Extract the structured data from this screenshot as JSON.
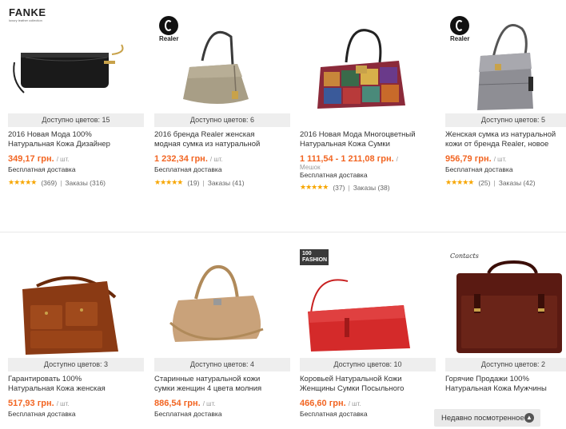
{
  "row1": [
    {
      "brand": "FANKE",
      "brand_sub": "luxury leather collection",
      "colors": "Доступно цветов: 15",
      "title_lines": [
        "2016 Новая Мода 100%",
        "Натуральная Кожа Дизайнер"
      ],
      "price": "349,17 грн.",
      "unit": "/ шт.",
      "shipping": "Бесплатная доставка",
      "reviews": "(369)",
      "orders": "Заказы (316)",
      "bag_color": "#1a1a1a"
    },
    {
      "brand": "Realer",
      "colors": "Доступно цветов: 6",
      "title_lines": [
        "2016 бренда Realer женская",
        "модная сумка из натуральной"
      ],
      "price": "1 232,34 грн.",
      "unit": "/ шт.",
      "shipping": "Бесплатная доставка",
      "reviews": "(19)",
      "orders": "Заказы (41)",
      "bag_color": "#a89e86"
    },
    {
      "colors": "",
      "title_lines": [
        "2016 Новая Мода Многоцветный",
        "Натуральная Кожа Сумки"
      ],
      "price": "1 111,54 - 1 211,08 грн.",
      "unit": "/",
      "unit_line": "Мешок",
      "shipping": "Бесплатная доставка",
      "reviews": "(37)",
      "orders": "Заказы (38)",
      "bag_color": "#8b2a3a"
    },
    {
      "brand": "Realer",
      "colors": "Доступно цветов: 5",
      "title_lines": [
        "Женская сумка из натуральной",
        "кожи от бренда Realer, новое"
      ],
      "price": "956,79 грн.",
      "unit": "/ шт.",
      "shipping": "Бесплатная доставка",
      "reviews": "(25)",
      "orders": "Заказы (42)",
      "bag_color": "#8e8e94"
    }
  ],
  "row2": [
    {
      "colors": "Доступно цветов: 3",
      "title_lines": [
        "Гарантировать 100%",
        "Натуральная Кожа женская"
      ],
      "price": "517,93 грн.",
      "unit": "/ шт.",
      "shipping": "Бесплатная доставка",
      "bag_color": "#8a3a14"
    },
    {
      "colors": "Доступно цветов: 4",
      "title_lines": [
        "Старинные натуральной кожи",
        "сумки женщин 4 цвета молния"
      ],
      "price": "886,54 грн.",
      "unit": "/ шт.",
      "shipping": "Бесплатная доставка",
      "bag_color": "#c9a27a"
    },
    {
      "brand": "100 FASHION",
      "colors": "Доступно цветов: 10",
      "title_lines": [
        "Коровьей Натуральной Кожи",
        "Женщины Сумки Посыльного"
      ],
      "price": "466,60 грн.",
      "unit": "/ шт.",
      "shipping": "Бесплатная доставка",
      "bag_color": "#d42a2a"
    },
    {
      "brand": "Contacts",
      "colors": "Доступно цветов: 2",
      "title_lines": [
        "Горячие Продажи 100%",
        "Натуральная Кожа Мужчины"
      ],
      "price": "",
      "unit": "",
      "shipping": "",
      "bag_color": "#5a1a12"
    }
  ],
  "recently_viewed": "Недавно посмотренное"
}
